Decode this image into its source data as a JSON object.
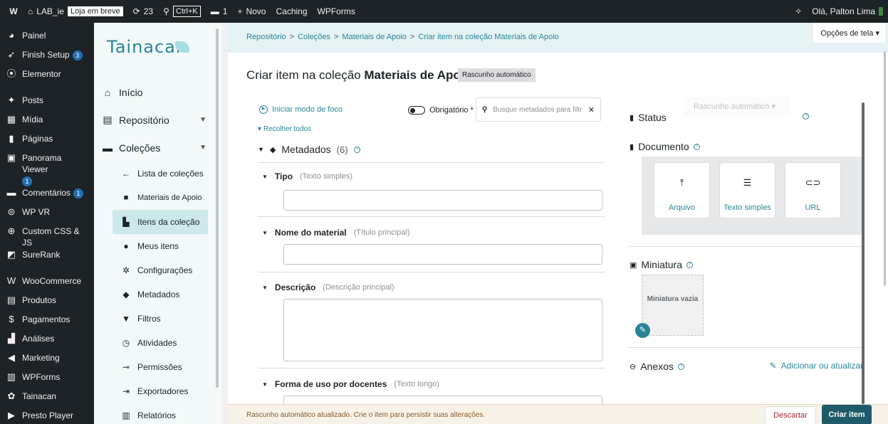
{
  "adminbar": {
    "site": "LAB_ie",
    "store_badge": "Loja em breve",
    "updates": "23",
    "shortcut": "Ctrl+K",
    "comments": "1",
    "new": "Novo",
    "caching": "Caching",
    "wpforms": "WPForms",
    "greeting": "Olá, Palton Lima"
  },
  "wpmenu": {
    "items": [
      {
        "icon": "dashboard-icon",
        "label": "Painel"
      },
      {
        "icon": "rocket-icon",
        "label": "Finish Setup",
        "badge": "3"
      },
      {
        "icon": "elementor-icon",
        "label": "Elementor"
      },
      {
        "icon": "pin-icon",
        "label": "Posts"
      },
      {
        "icon": "media-icon",
        "label": "Mídia"
      },
      {
        "icon": "page-icon",
        "label": "Páginas"
      },
      {
        "icon": "panorama-icon",
        "label": "Panorama Viewer",
        "badge": "1"
      },
      {
        "icon": "comment-icon",
        "label": "Comentários",
        "badge": "1"
      },
      {
        "icon": "vr-icon",
        "label": "WP VR"
      },
      {
        "icon": "plus-circle-icon",
        "label": "Custom CSS & JS"
      },
      {
        "icon": "surerank-icon",
        "label": "SureRank"
      },
      {
        "icon": "woo-icon",
        "label": "WooCommerce"
      },
      {
        "icon": "products-icon",
        "label": "Produtos"
      },
      {
        "icon": "payment-icon",
        "label": "Pagamentos"
      },
      {
        "icon": "chart-icon",
        "label": "Análises"
      },
      {
        "icon": "megaphone-icon",
        "label": "Marketing"
      },
      {
        "icon": "form-icon",
        "label": "WPForms"
      },
      {
        "icon": "tainacan-icon",
        "label": "Tainacan"
      },
      {
        "icon": "play-icon",
        "label": "Presto Player"
      }
    ]
  },
  "tainacan": {
    "logo": "Tainacan",
    "nav": {
      "inicio": "Início",
      "repositorio": "Repositório",
      "colecoes": "Coleções",
      "lista": "Lista de coleções",
      "materiais": "Materiais de Apoio",
      "itens": "Itens da coleção",
      "meus": "Meus itens",
      "config": "Configurações",
      "metadados": "Metadados",
      "filtros": "Filtros",
      "atividades": "Atividades",
      "permissoes": "Permissões",
      "exportadores": "Exportadores",
      "relatorios": "Relatórios"
    }
  },
  "breadcrumb": [
    "Repositório",
    "Coleções",
    "Materiais de Apoio",
    "Criar item na coleção Materiais de Apoio"
  ],
  "screen_options": "Opções de tela",
  "page": {
    "title_prefix": "Criar item na coleção ",
    "title_collection": "Materiais de Apoio",
    "chip": "Rascunho automático",
    "focus_mode": "Iniciar modo de foco",
    "required_toggle": "Obrigatório *",
    "search_placeholder": "Busque metadados para filtr",
    "collapse_all": "Recolher todos",
    "metadata_title": "Metadados",
    "metadata_count": "(6)",
    "fields": [
      {
        "label": "Tipo",
        "type": "(Texto simples)"
      },
      {
        "label": "Nome do material",
        "type": "(Título principal)"
      },
      {
        "label": "Descrição",
        "type": "(Descrição principal)"
      },
      {
        "label": "Forma de uso por docentes",
        "type": "(Texto longo)"
      }
    ]
  },
  "right": {
    "status_label": "Status",
    "status_value": "Rascunho automático",
    "documento_label": "Documento",
    "doc_buttons": [
      "Arquivo",
      "Texto simples",
      "URL"
    ],
    "miniatura_label": "Miniatura",
    "miniatura_empty": "Miniatura vazia",
    "anexos_label": "Anexos",
    "anexos_action": "Adicionar ou atualizar"
  },
  "footer": {
    "message": "Rascunho automático atualizado. Crie o item para persistir suas alterações.",
    "discard": "Descartar",
    "create": "Criar item"
  }
}
